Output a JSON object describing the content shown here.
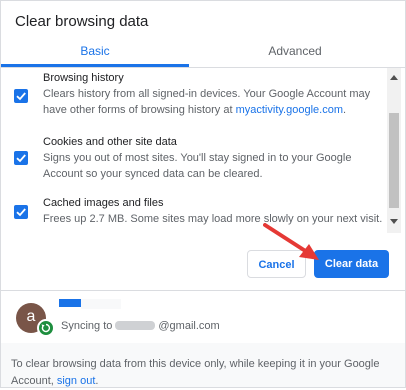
{
  "dialog": {
    "title": "Clear browsing data",
    "tabs": [
      {
        "label": "Basic",
        "selected": true
      },
      {
        "label": "Advanced",
        "selected": false
      }
    ]
  },
  "items": [
    {
      "title": "Browsing history",
      "checked": true,
      "desc_1": "Clears history from all signed-in devices. Your Google Account may have other forms of browsing history at ",
      "desc_link": "myactivity.google.com",
      "desc_2": "."
    },
    {
      "title": "Cookies and other site data",
      "checked": true,
      "desc_1": "Signs you out of most sites. You'll stay signed in to your Google Account so your synced data can be cleared."
    },
    {
      "title": "Cached images and files",
      "checked": true,
      "desc_1": "Frees up 2.7 MB. Some sites may load more slowly on your next visit."
    }
  ],
  "buttons": {
    "cancel": "Cancel",
    "clear": "Clear data"
  },
  "account": {
    "avatar_letter": "a",
    "sync_prefix": "Syncing to",
    "email_suffix": "@gmail.com"
  },
  "footer": {
    "text": "To clear browsing data from this device only, while keeping it in your Google Account, ",
    "link": "sign out",
    "end": "."
  },
  "colors": {
    "accent": "#1a73e8",
    "annotation_arrow": "#e53935",
    "sync_badge": "#1e8e3e",
    "avatar": "#795548"
  },
  "icons": {
    "checkbox": "check-icon",
    "sync": "sync-icon",
    "annotation": "red-arrow-icon"
  }
}
